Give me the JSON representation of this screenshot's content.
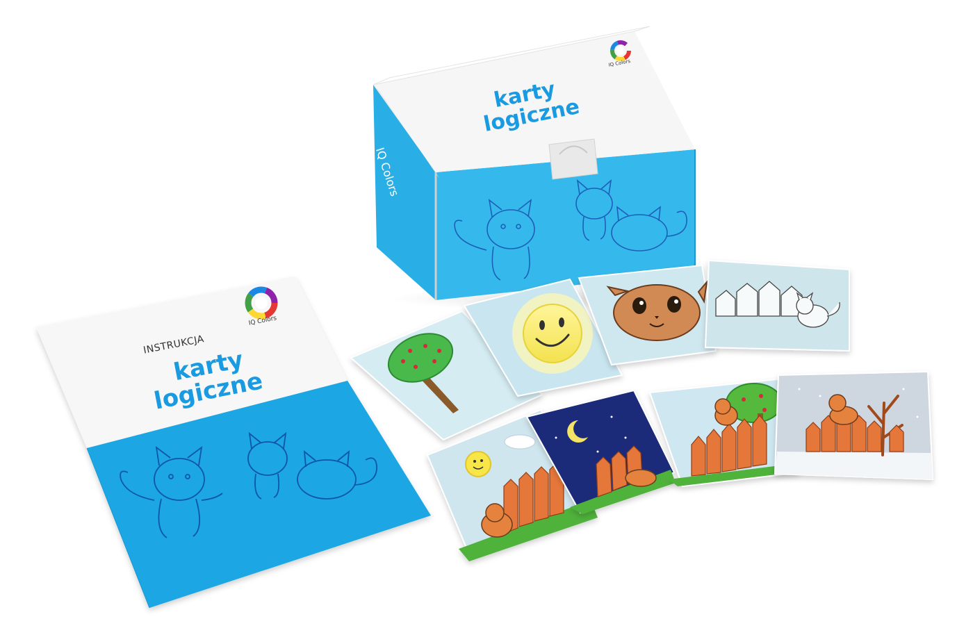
{
  "booklet": {
    "heading": "INSTRUKCJA",
    "title_line1": "karty",
    "title_line2": "logiczne",
    "brand": "IQ Colors"
  },
  "box": {
    "title_line1": "karty",
    "title_line2": "logiczne",
    "brand": "IQ Colors",
    "side_brand": "IQ Colors"
  },
  "colors": {
    "brand_blue": "#1a9ae0",
    "light_blue": "#2db4ea",
    "card_sky": "#cfe6ee",
    "grass": "#5cb83a",
    "fence": "#e2763c",
    "night": "#1f2a7a",
    "sun": "#f6e85a"
  },
  "cards": [
    {
      "name": "tree-card",
      "picture": "tree"
    },
    {
      "name": "sun-card",
      "picture": "sun"
    },
    {
      "name": "cat-face-card",
      "picture": "cat-face"
    },
    {
      "name": "fence-outline-card",
      "picture": "fence-outline"
    },
    {
      "name": "day-scene-card",
      "picture": "sun-fence-cat"
    },
    {
      "name": "night-scene-card",
      "picture": "moon-fence-cat"
    },
    {
      "name": "autumn-scene-card",
      "picture": "tree-fence-cat"
    },
    {
      "name": "winter-scene-card",
      "picture": "snow-fence-cat"
    }
  ]
}
